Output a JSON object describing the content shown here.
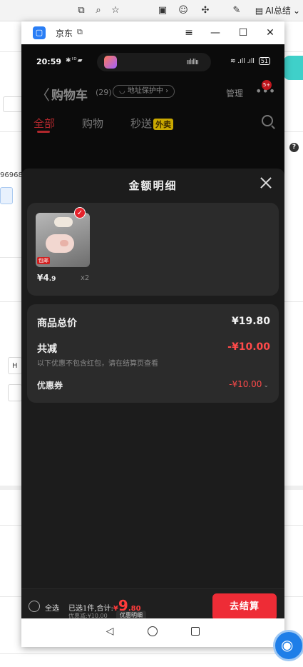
{
  "browser": {
    "ai_summary_label": "AI总结",
    "bg_text_1": "96968.",
    "bg_text_2": "H",
    "bg_help_icon": "?"
  },
  "window": {
    "title": "京东",
    "controls": [
      "menu",
      "minimize",
      "maximize",
      "close"
    ]
  },
  "status_bar": {
    "time": "20:59",
    "battery": "51"
  },
  "cart": {
    "title": "购物车",
    "count": "(29)",
    "address_protect": "地址保护中",
    "manage": "管理",
    "badge": "5+",
    "tabs": [
      {
        "label": "全部",
        "active": true
      },
      {
        "label": "购物",
        "active": false
      },
      {
        "label": "秒送",
        "active": false,
        "tag": "外卖"
      }
    ]
  },
  "sheet": {
    "title": "金额明细",
    "item": {
      "price_main": "¥4",
      "price_decimal": ".9",
      "quantity": "x2",
      "thumb_tag": "包邮"
    },
    "summary": {
      "total_label": "商品总价",
      "total_value": "¥19.80",
      "discount_label": "共减",
      "discount_value": "-¥10.00",
      "discount_note": "以下优惠不包含红包，请在结算页查看",
      "coupon_label": "优惠券",
      "coupon_value": "-¥10.00"
    }
  },
  "bottom_bar": {
    "select_all": "全选",
    "selected_text": "已选1件,合计:",
    "currency": "¥",
    "total_integer": "9",
    "total_decimal": ".80",
    "discount_text": "优惠减:¥10.00",
    "detail_tag": "优惠明细",
    "checkout": "去结算"
  },
  "colors": {
    "accent_red": "#ee2c36",
    "price_red": "#ff4a4a",
    "sheet_bg": "#1c1c1c",
    "card_bg": "#2b2b2b"
  }
}
